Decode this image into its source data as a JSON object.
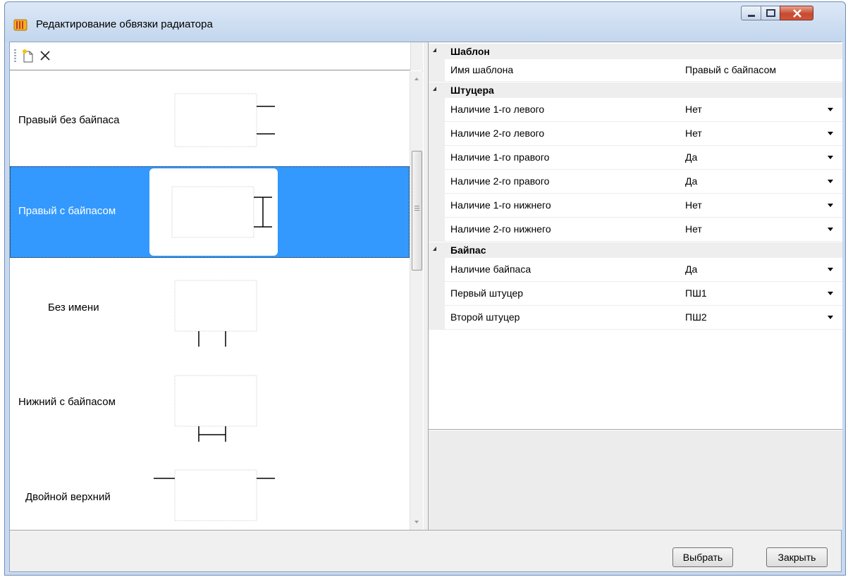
{
  "window": {
    "title": "Редактирование обвязки радиатора"
  },
  "toolbar": {
    "new_icon": "new-document-icon",
    "delete_icon": "delete-x-icon"
  },
  "templates": [
    {
      "label": "Правый без байпаса",
      "schema": "right-no-bypass",
      "selected": false
    },
    {
      "label": "Правый с байпасом",
      "schema": "right-bypass",
      "selected": true
    },
    {
      "label": "Без имени",
      "schema": "bottom-two",
      "selected": false
    },
    {
      "label": "Нижний с байпасом",
      "schema": "bottom-bypass",
      "selected": false
    },
    {
      "label": "Двойной верхний",
      "schema": "double-top",
      "selected": false
    }
  ],
  "properties": {
    "categories": [
      {
        "label": "Шаблон",
        "rows": [
          {
            "name": "Имя шаблона",
            "value": "Правый с байпасом",
            "dropdown": false
          }
        ]
      },
      {
        "label": "Штуцера",
        "rows": [
          {
            "name": "Наличие 1-го левого",
            "value": "Нет",
            "dropdown": true
          },
          {
            "name": "Наличие 2-го левого",
            "value": "Нет",
            "dropdown": true
          },
          {
            "name": "Наличие 1-го правого",
            "value": "Да",
            "dropdown": true
          },
          {
            "name": "Наличие 2-го правого",
            "value": "Да",
            "dropdown": true
          },
          {
            "name": "Наличие 1-го нижнего",
            "value": "Нет",
            "dropdown": true
          },
          {
            "name": "Наличие 2-го нижнего",
            "value": "Нет",
            "dropdown": true
          }
        ]
      },
      {
        "label": "Байпас",
        "rows": [
          {
            "name": "Наличие байпаса",
            "value": "Да",
            "dropdown": true
          },
          {
            "name": "Первый штуцер",
            "value": "ПШ1",
            "dropdown": true
          },
          {
            "name": "Второй штуцер",
            "value": "ПШ2",
            "dropdown": true
          }
        ]
      }
    ]
  },
  "buttons": {
    "select_label": "Выбрать",
    "close_label": "Закрыть"
  },
  "colors": {
    "selection": "#3399ff",
    "category_bg": "#eeeeee"
  }
}
